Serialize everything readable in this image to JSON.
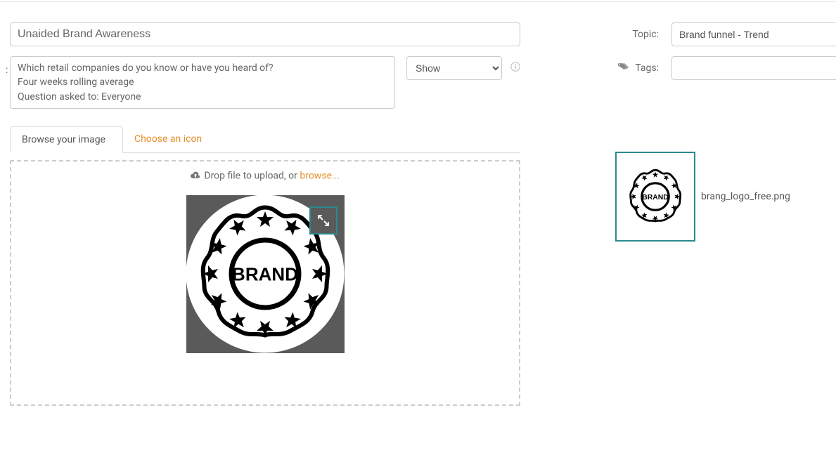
{
  "form": {
    "title": "Unaided Brand Awareness",
    "description": "Which retail companies do you know or have you heard of?\nFour weeks rolling average\nQuestion asked to: Everyone",
    "visibility_selected": "Show",
    "visibility_options": [
      "Show"
    ]
  },
  "tabs": {
    "browse_image": "Browse your image",
    "choose_icon": "Choose an icon"
  },
  "dropzone": {
    "instruction_prefix": "Drop file to upload, or ",
    "browse_text": "browse...",
    "brand_text": "BRAND"
  },
  "right": {
    "topic_label": "Topic:",
    "topic_value": "Brand funnel - Trend",
    "tags_label": "Tags:",
    "tags_value": ""
  },
  "thumbnail": {
    "filename": "brang_logo_free.png",
    "brand_text": "BRAND"
  },
  "colors": {
    "accent_orange": "#e8902a",
    "accent_teal": "#2b8a8f"
  }
}
